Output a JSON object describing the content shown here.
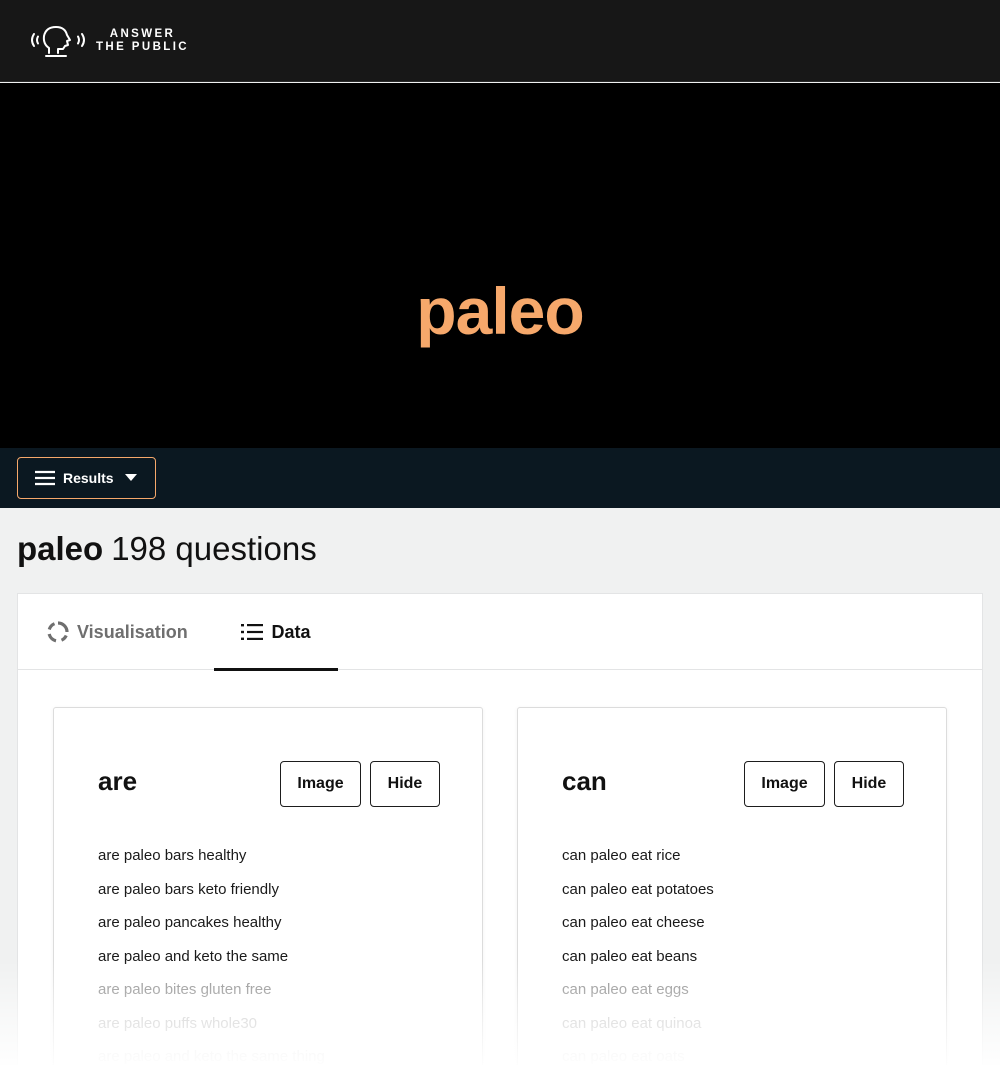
{
  "brand": {
    "line1": "ANSWER",
    "line2": "THE PUBLIC",
    "logo_icon": "speaking-head-icon"
  },
  "hero": {
    "keyword": "paleo"
  },
  "toolbar": {
    "results_label": "Results",
    "menu_icon": "hamburger-icon",
    "caret_icon": "caret-down-icon"
  },
  "summary": {
    "keyword": "paleo",
    "count_label": "198 questions"
  },
  "tabs": [
    {
      "label": "Visualisation",
      "icon": "circle-dial-icon",
      "active": false
    },
    {
      "label": "Data",
      "icon": "list-icon",
      "active": true
    }
  ],
  "cards": [
    {
      "title": "are",
      "image_label": "Image",
      "hide_label": "Hide",
      "items": [
        "are paleo bars healthy",
        "are paleo bars keto friendly",
        "are paleo pancakes healthy",
        "are paleo and keto the same",
        "are paleo bites gluten free",
        "are paleo puffs whole30",
        "are paleo and keto the same thing"
      ]
    },
    {
      "title": "can",
      "image_label": "Image",
      "hide_label": "Hide",
      "items": [
        "can paleo eat rice",
        "can paleo eat potatoes",
        "can paleo eat cheese",
        "can paleo eat beans",
        "can paleo eat eggs",
        "can paleo eat quinoa",
        "can paleo eat oats"
      ]
    }
  ],
  "colors": {
    "accent": "#f6a86b",
    "hero_bg": "#000000",
    "topbar_bg": "#171717",
    "resultsbar_bg": "#0b1821",
    "page_bg": "#f0f1f1"
  }
}
